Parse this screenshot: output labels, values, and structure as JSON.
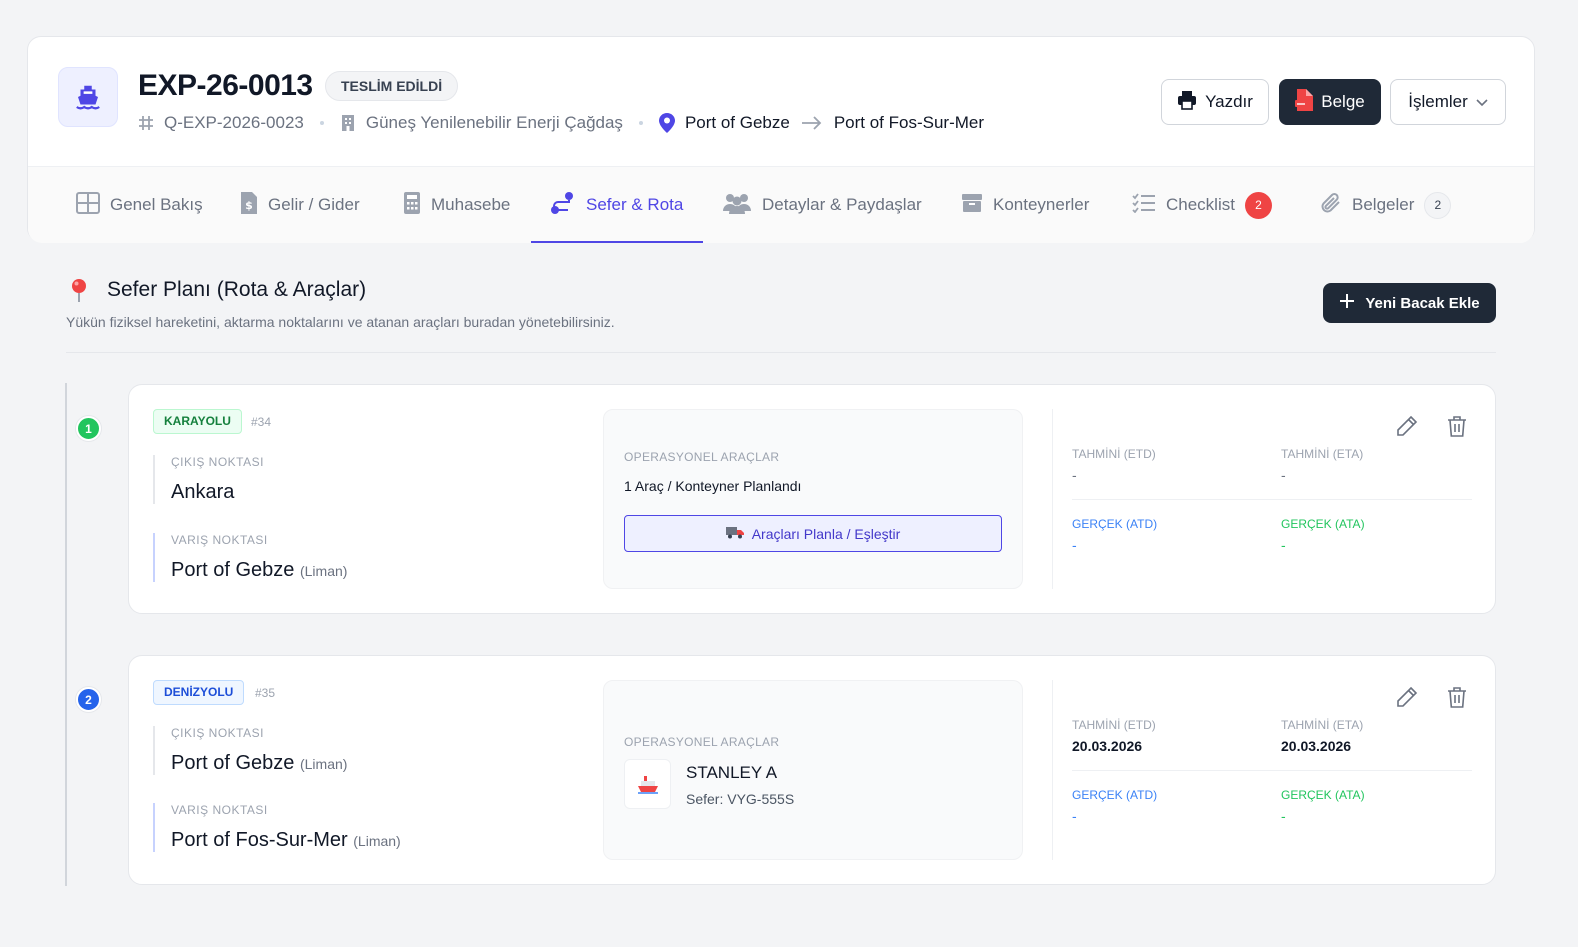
{
  "header": {
    "title": "EXP-26-0013",
    "status": "TESLİM EDİLDİ",
    "quote_no": "Q-EXP-2026-0023",
    "company": "Güneş Yenilenebilir Enerji Çağdaş",
    "origin_port": "Port of Gebze",
    "dest_port": "Port of Fos-Sur-Mer",
    "print_label": "Yazdır",
    "document_label": "Belge",
    "actions_label": "İşlemler"
  },
  "tabs": [
    {
      "label": "Genel Bakış"
    },
    {
      "label": "Gelir / Gider"
    },
    {
      "label": "Muhasebe"
    },
    {
      "label": "Sefer & Rota",
      "active": true
    },
    {
      "label": "Detaylar & Paydaşlar"
    },
    {
      "label": "Konteynerler"
    },
    {
      "label": "Checklist",
      "badge": "2"
    },
    {
      "label": "Belgeler",
      "badge": "2"
    }
  ],
  "plan": {
    "title": "Sefer Planı (Rota & Araçlar)",
    "subtitle": "Yükün fiziksel hareketini, aktarma noktalarını ve atanan araçları buradan yönetebilirsiniz.",
    "add_leg_label": "Yeni Bacak Ekle"
  },
  "labels": {
    "origin": "ÇIKIŞ NOKTASI",
    "destination": "VARIŞ NOKTASI",
    "ops_vehicles": "OPERASYONEL ARAÇLAR",
    "etd": "TAHMİNİ (ETD)",
    "eta": "TAHMİNİ (ETA)",
    "atd": "GERÇEK (ATD)",
    "ata": "GERÇEK (ATA)",
    "port_type": "(Liman)"
  },
  "legs": [
    {
      "step": "1",
      "mode": "KARAYOLU",
      "id": "#34",
      "origin": "Ankara",
      "destination": "Port of Gebze",
      "vehicles_planned": "1 Araç / Konteyner Planlandı",
      "plan_button": "Araçları Planla / Eşleştir",
      "etd": "-",
      "eta": "-",
      "atd": "-",
      "ata": "-"
    },
    {
      "step": "2",
      "mode": "DENİZYOLU",
      "id": "#35",
      "origin": "Port of Gebze",
      "destination": "Port of Fos-Sur-Mer",
      "vessel_name": "STANLEY A",
      "voyage": "Sefer: VYG-555S",
      "etd": "20.03.2026",
      "eta": "20.03.2026",
      "atd": "-",
      "ata": "-"
    }
  ],
  "colors": {
    "accent": "#4f46e5",
    "dark": "#1f2937",
    "step1": "#22c55e",
    "step2": "#2563eb",
    "danger": "#ef4444"
  }
}
